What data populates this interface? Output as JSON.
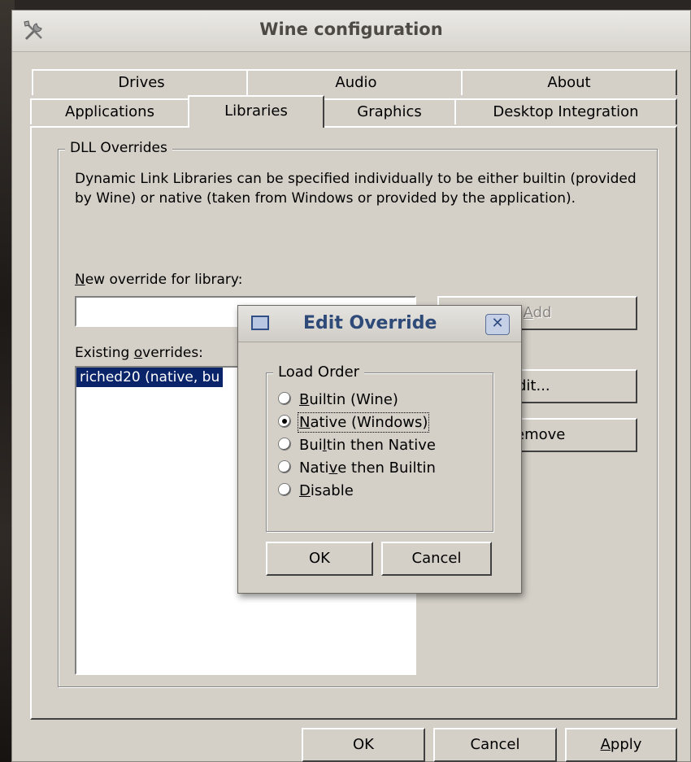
{
  "window": {
    "title": "Wine configuration",
    "icon": "tools-icon"
  },
  "tabs": {
    "row_top": [
      "Drives",
      "Audio",
      "About"
    ],
    "row_bottom": [
      "Applications",
      "Libraries",
      "Graphics",
      "Desktop Integration"
    ],
    "active": "Libraries"
  },
  "dll_overrides": {
    "group_label": "DLL Overrides",
    "description": "Dynamic Link Libraries can be specified individually to be either builtin (provided by Wine) or native (taken from Windows or provided by the application).",
    "new_override": {
      "label_mnemonic": "N",
      "label_rest": "ew override for library:",
      "value": ""
    },
    "add_button": {
      "label_mnemonic": "A",
      "label_rest": "dd"
    },
    "existing": {
      "label_prefix": "Existing ",
      "label_mnemonic": "o",
      "label_rest": "verrides:",
      "items": [
        "riched20 (native, bu"
      ]
    },
    "edit_button": "dit...",
    "remove_button": "emove"
  },
  "bottom_buttons": {
    "ok": "OK",
    "cancel": "Cancel",
    "apply_mnemonic": "A",
    "apply_rest": "pply"
  },
  "edit_override_dialog": {
    "title": "Edit Override",
    "group_label": "Load Order",
    "options": [
      {
        "pre": "",
        "mn": "B",
        "post": "uiltin (Wine)",
        "selected": false
      },
      {
        "pre": "",
        "mn": "N",
        "post": "ative (Windows)",
        "selected": true
      },
      {
        "pre": "Bui",
        "mn": "l",
        "post": "tin then Native",
        "selected": false
      },
      {
        "pre": "Nati",
        "mn": "v",
        "post": "e then Builtin",
        "selected": false
      },
      {
        "pre": "",
        "mn": "D",
        "post": "isable",
        "selected": false
      }
    ],
    "ok": "OK",
    "cancel": "Cancel"
  }
}
